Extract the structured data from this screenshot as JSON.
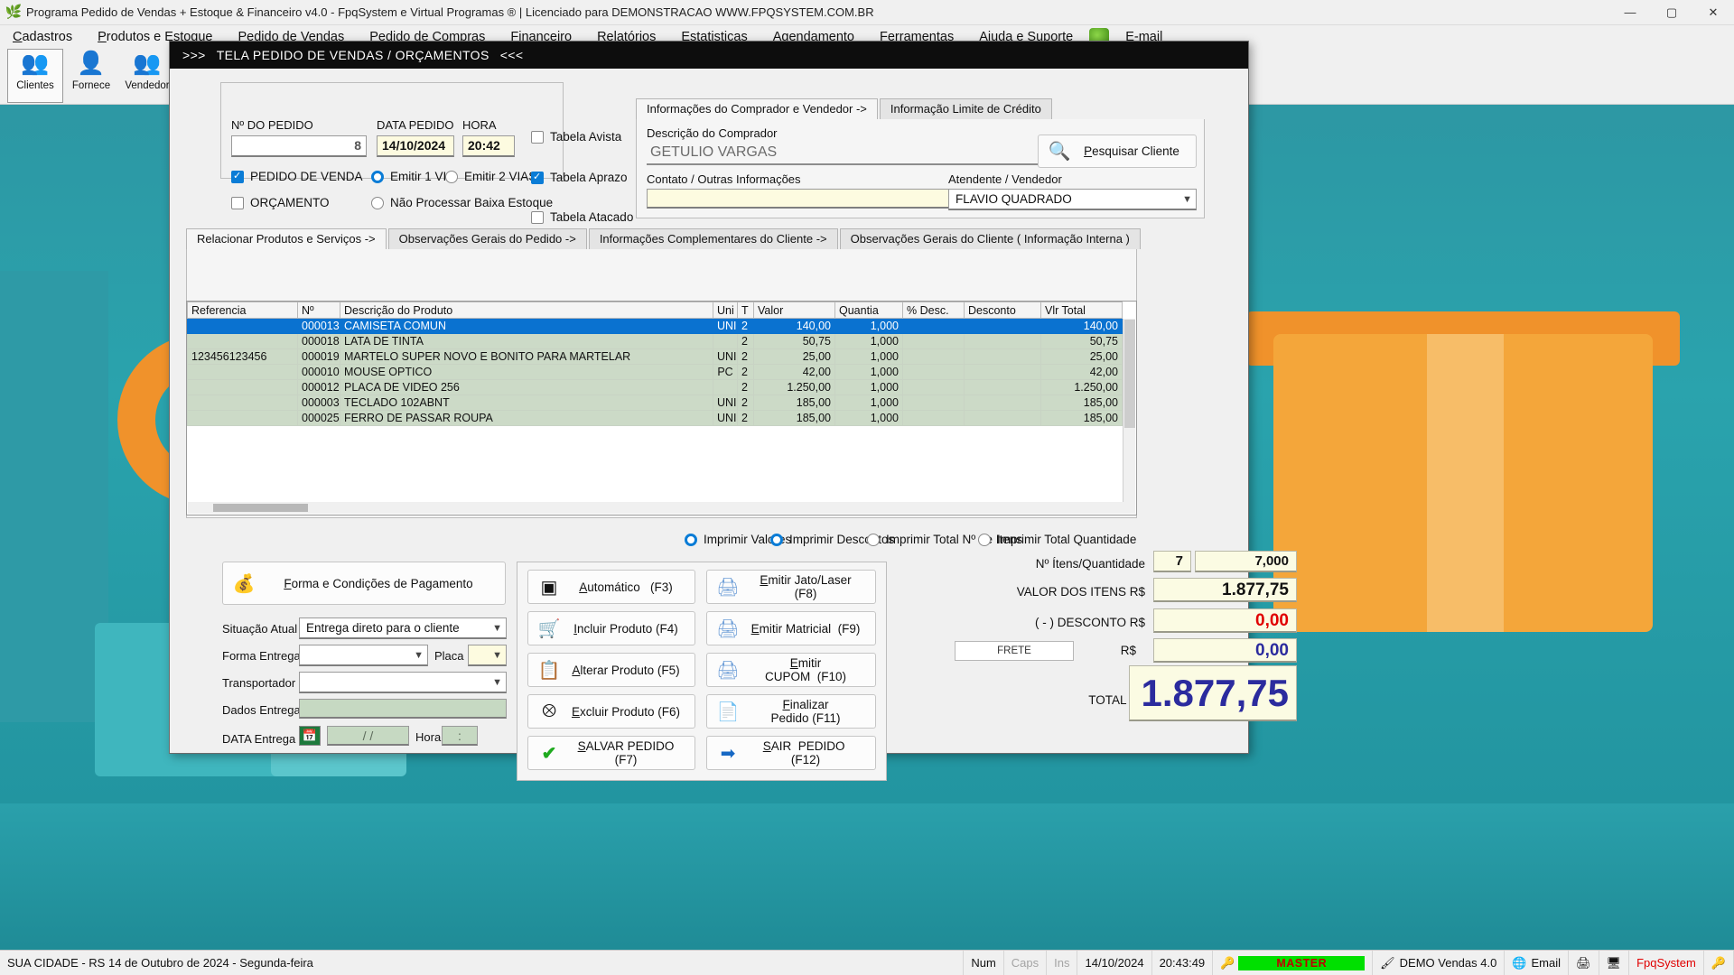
{
  "window": {
    "title": "Programa Pedido de Vendas + Estoque & Financeiro v4.0 - FpqSystem e Virtual Programas ® | Licenciado para  DEMONSTRACAO WWW.FPQSYSTEM.COM.BR",
    "app_icon": "leaf-icon",
    "minimize": "—",
    "maximize": "▢",
    "close": "✕"
  },
  "menubar": {
    "items": [
      {
        "label": "Cadastros"
      },
      {
        "label": "Produtos e Estoque"
      },
      {
        "label": "Pedido de Vendas"
      },
      {
        "label": "Pedido de Compras"
      },
      {
        "label": "Financeiro"
      },
      {
        "label": "Relatórios"
      },
      {
        "label": "Estatisticas"
      },
      {
        "label": "Agendamento"
      },
      {
        "label": "Ferramentas"
      },
      {
        "label": "Ajuda e Suporte"
      },
      {
        "label": "E-mail"
      }
    ]
  },
  "toolbar": {
    "items": [
      {
        "label": "Clientes",
        "icon": "clients-people-icon"
      },
      {
        "label": "Fornece",
        "icon": "supplier-person-icon"
      },
      {
        "label": "Vendedor",
        "icon": "salesperson-people-icon"
      }
    ]
  },
  "order_window": {
    "title_left": ">>>",
    "title": "TELA PEDIDO DE VENDAS / ORÇAMENTOS",
    "title_right": "<<<"
  },
  "order_header": {
    "numero_label": "Nº DO PEDIDO",
    "numero_value": "8",
    "data_label": "DATA PEDIDO",
    "data_value": "14/10/2024",
    "hora_label": "HORA",
    "hora_value": "20:42",
    "checks": [
      {
        "label": "PEDIDO DE VENDA",
        "checked": true
      },
      {
        "label": "ORÇAMENTO",
        "checked": false
      }
    ],
    "radios_via": [
      {
        "label": "Emitir 1 VIA",
        "checked": true
      },
      {
        "label": "Emitir 2 VIAS",
        "checked": false
      },
      {
        "label": "Não Processar Baixa Estoque",
        "checked": false
      }
    ],
    "tabelas": [
      {
        "label": "Tabela Avista",
        "checked": false
      },
      {
        "label": "Tabela Aprazo",
        "checked": true
      },
      {
        "label": "Tabela Atacado",
        "checked": false
      }
    ]
  },
  "buyer_panel": {
    "tabs": [
      {
        "label": "Informações do Comprador e Vendedor  ->",
        "active": true
      },
      {
        "label": "Informação Limite de Crédito",
        "active": false
      }
    ],
    "comprador_label": "Descrição do Comprador",
    "comprador_value": "GETULIO VARGAS",
    "contato_label": "Contato / Outras Informações",
    "contato_value": "",
    "pesquisar_button": "Pesquisar Cliente",
    "pesquisar_icon": "search-client-icon",
    "atendente_label": "Atendente / Vendedor",
    "atendente_value": "FLAVIO QUADRADO"
  },
  "products_tabs": [
    {
      "label": "Relacionar Produtos e Serviços  ->",
      "active": true
    },
    {
      "label": "Observações Gerais do Pedido  ->",
      "active": false
    },
    {
      "label": "Informações Complementares do Cliente  ->",
      "active": false
    },
    {
      "label": "Observações Gerais do Cliente ( Informação Interna )",
      "active": false
    }
  ],
  "grid": {
    "columns": [
      "Referencia",
      "Nº",
      "Descrição do Produto",
      "Uni",
      "T",
      "Valor",
      "Quantia",
      "% Desc.",
      "Desconto",
      "Vlr Total"
    ],
    "rows": [
      {
        "referencia": "",
        "numero": "000013",
        "descricao": "CAMISETA COMUN",
        "uni": "UNI",
        "t": "2",
        "valor": "140,00",
        "quantia": "1,000",
        "perc_desc": "",
        "desconto": "",
        "vlr_total": "140,00",
        "selected": true
      },
      {
        "referencia": "",
        "numero": "000018",
        "descricao": "LATA DE TINTA",
        "uni": "",
        "t": "2",
        "valor": "50,75",
        "quantia": "1,000",
        "perc_desc": "",
        "desconto": "",
        "vlr_total": "50,75",
        "selected": false
      },
      {
        "referencia": "123456123456",
        "numero": "000019",
        "descricao": "MARTELO SUPER NOVO E BONITO PARA MARTELAR",
        "uni": "UNI",
        "t": "2",
        "valor": "25,00",
        "quantia": "1,000",
        "perc_desc": "",
        "desconto": "",
        "vlr_total": "25,00",
        "selected": false
      },
      {
        "referencia": "",
        "numero": "000010",
        "descricao": "MOUSE OPTICO",
        "uni": "PC",
        "t": "2",
        "valor": "42,00",
        "quantia": "1,000",
        "perc_desc": "",
        "desconto": "",
        "vlr_total": "42,00",
        "selected": false
      },
      {
        "referencia": "",
        "numero": "000012",
        "descricao": "PLACA DE VIDEO 256",
        "uni": "",
        "t": "2",
        "valor": "1.250,00",
        "quantia": "1,000",
        "perc_desc": "",
        "desconto": "",
        "vlr_total": "1.250,00",
        "selected": false
      },
      {
        "referencia": "",
        "numero": "000003",
        "descricao": "TECLADO 102ABNT",
        "uni": "UNI",
        "t": "2",
        "valor": "185,00",
        "quantia": "1,000",
        "perc_desc": "",
        "desconto": "",
        "vlr_total": "185,00",
        "selected": false
      },
      {
        "referencia": "",
        "numero": "000025",
        "descricao": "FERRO DE PASSAR ROUPA",
        "uni": "UNI",
        "t": "2",
        "valor": "185,00",
        "quantia": "1,000",
        "perc_desc": "",
        "desconto": "",
        "vlr_total": "185,00",
        "selected": false
      }
    ]
  },
  "print_options": [
    {
      "label": "Imprimir Valores",
      "checked": true
    },
    {
      "label": "Imprimir Descontos",
      "checked": true
    },
    {
      "label": "Imprimir Total Nº de Itens",
      "checked": false
    },
    {
      "label": "Imprimir Total Quantidade",
      "checked": false
    }
  ],
  "payment_panel": {
    "button_label": "Forma e Condições de Pagamento",
    "button_icon": "coin-money-icon",
    "situacao_label": "Situação Atual",
    "situacao_value": "Entrega direto para o cliente",
    "forma_entrega_label": "Forma Entrega",
    "forma_entrega_value": "",
    "placa_label": "Placa",
    "placa_value": "",
    "transportador_label": "Transportador",
    "transportador_value": "",
    "dados_entrega_label": "Dados Entrega",
    "dados_entrega_value": "",
    "data_entrega_label": "DATA Entrega",
    "data_entrega_value": "/  /",
    "calendar_icon": "calendar-icon",
    "hora_label": "Hora",
    "hora_value": ":"
  },
  "action_buttons_left": [
    {
      "label": "Automático",
      "hotkey": "(F3)",
      "icon": "barcode-scanner-icon"
    },
    {
      "label": "Incluir Produto",
      "hotkey": "(F4)",
      "icon": "add-cart-icon"
    },
    {
      "label": "Alterar Produto",
      "hotkey": "(F5)",
      "icon": "edit-table-icon"
    },
    {
      "label": "Excluir Produto",
      "hotkey": "(F6)",
      "icon": "delete-table-icon"
    },
    {
      "label": "SALVAR PEDIDO",
      "hotkey": "(F7)",
      "icon": "green-check-icon"
    }
  ],
  "action_buttons_right": [
    {
      "label": "Emitir Jato/Laser",
      "hotkey": "(F8)",
      "icon": "printer-icon"
    },
    {
      "label": "Emitir Matricial",
      "hotkey": "(F9)",
      "icon": "printer-icon"
    },
    {
      "label": "Emitir CUPOM",
      "hotkey": "(F10)",
      "icon": "printer-icon"
    },
    {
      "label": "Finalizar Pedido",
      "hotkey": "(F11)",
      "icon": "document-check-icon"
    },
    {
      "label": "SAIR  PEDIDO",
      "hotkey": "(F12)",
      "icon": "exit-arrow-icon"
    }
  ],
  "totals": {
    "itens_label": "Nº Ítens/Quantidade",
    "itens_count": "7",
    "itens_quantidade": "7,000",
    "valor_itens_label": "VALOR DOS ITENS R$",
    "valor_itens": "1.877,75",
    "desconto_label": "( - ) DESCONTO R$",
    "desconto": "0,00",
    "frete_button": "FRETE",
    "frete_rs_label": "R$",
    "frete": "0,00",
    "total_label": "TOTAL R$",
    "total": "1.877,75"
  },
  "colors": {
    "accent_blue": "#0a72d0",
    "total_blue": "#2b2b9e",
    "discount_red": "#e00000",
    "grid_row_green": "#ccdac7",
    "field_cream": "#fdfbe0",
    "master_green": "#00e000"
  },
  "statusbar": {
    "left_text": "SUA CIDADE - RS 14 de Outubro de 2024 - Segunda-feira",
    "num": "Num",
    "caps": "Caps",
    "ins": "Ins",
    "date": "14/10/2024",
    "time": "20:43:49",
    "master": "MASTER",
    "master_icon": "user-key-icon",
    "demo": "DEMO Vendas 4.0",
    "demo_icon": "brush-icon",
    "email": "Email",
    "email_icon": "globe-mail-icon",
    "printer_icon": "printer-icon",
    "network_icon": "network-icon",
    "fpq": "FpqSystem",
    "fpq_icon": "user-key-icon"
  }
}
